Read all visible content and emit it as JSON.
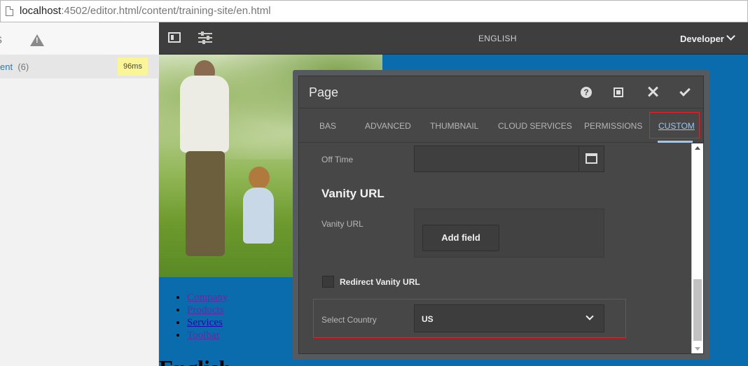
{
  "browser": {
    "url_host": "localhost",
    "url_path": ":4502/editor.html/content/training-site/en.html"
  },
  "left_panel": {
    "partial_label": "s",
    "row": {
      "label": "ent",
      "count": "(6)",
      "badge": "96ms"
    }
  },
  "editor_bar": {
    "page_title": "ENGLISH",
    "mode": "Developer"
  },
  "page": {
    "nav": [
      "Company",
      "Products",
      "Services",
      "Toolbar"
    ],
    "heading": "English"
  },
  "dialog": {
    "title": "Page",
    "help_glyph": "?",
    "tabs": [
      "BAS",
      "ADVANCED",
      "THUMBNAIL",
      "CLOUD SERVICES",
      "PERMISSIONS",
      "CUSTOM"
    ],
    "active_tab": "CUSTOM",
    "off_time": {
      "label": "Off Time",
      "value": ""
    },
    "vanity": {
      "section_title": "Vanity URL",
      "label": "Vanity URL",
      "add_button": "Add field"
    },
    "redirect": {
      "label": "Redirect Vanity URL",
      "checked": false
    },
    "country": {
      "label": "Select Country",
      "value": "US"
    }
  },
  "colors": {
    "highlight": "#e8202a",
    "accent": "#9ac7f5",
    "page_bg": "#0a6cad"
  }
}
